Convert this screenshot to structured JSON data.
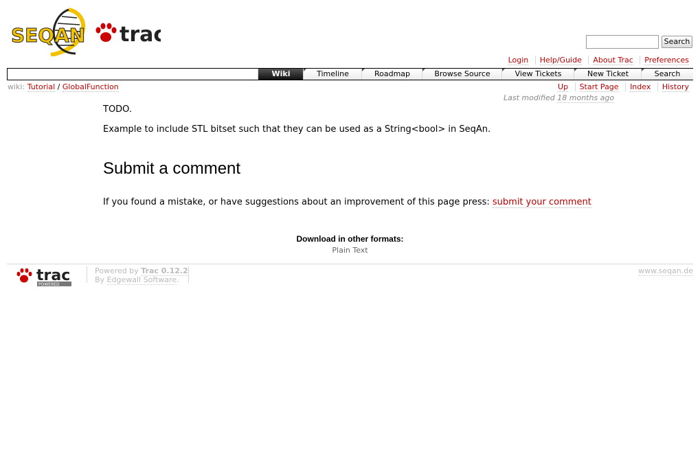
{
  "header": {
    "logo_text_seqan": "SEQAN",
    "logo_text_trac": "trac",
    "search_placeholder": "",
    "search_button": "Search"
  },
  "metanav": [
    "Login",
    "Help/Guide",
    "About Trac",
    "Preferences"
  ],
  "mainnav": [
    "Wiki",
    "Timeline",
    "Roadmap",
    "Browse Source",
    "View Tickets",
    "New Ticket",
    "Search"
  ],
  "breadcrumb": {
    "prefix": "wiki:",
    "items": [
      "Tutorial",
      "GlobalFunction"
    ],
    "separator": "/"
  },
  "ctxtnav": [
    "Up",
    "Start Page",
    "Index",
    "History"
  ],
  "last_modified": {
    "label": "Last modified",
    "age": "18 months ago"
  },
  "content": {
    "todo": "TODO.",
    "example": "Example to include STL bitset such that they can be used as a String<bool> in SeqAn.",
    "heading": "Submit a comment",
    "comment_text": "If you found a mistake, or have suggestions about an improvement of this page press:",
    "comment_link": "submit your comment"
  },
  "altlinks": {
    "title": "Download in other formats:",
    "item": "Plain Text"
  },
  "footer": {
    "logo_text": "trac",
    "logo_sub": "POWERED",
    "powered_by": "Powered by",
    "trac_version": "Trac 0.12.2",
    "by": "By",
    "edgewall": "Edgewall Software",
    "site": "www.seqan.de"
  },
  "colors": {
    "link": "#bb0000",
    "logo_yellow": "#f2c200",
    "nav_active": "#222222"
  }
}
